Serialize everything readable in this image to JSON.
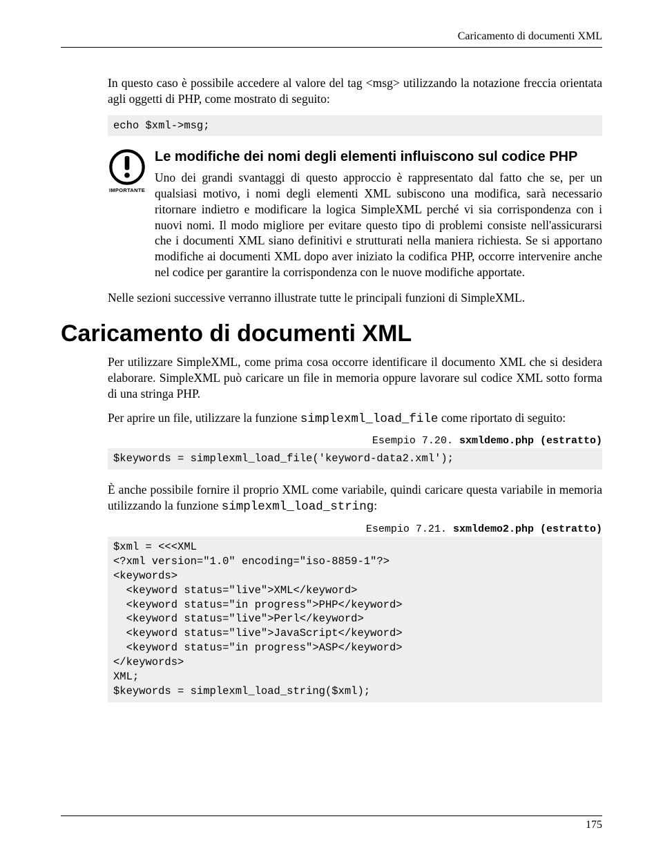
{
  "running_head": "Caricamento di documenti XML",
  "para1": "In questo caso è possibile accedere al valore del tag <msg> utilizzando la notazione freccia orientata agli oggetti di PHP, come mostrato di seguito:",
  "code1": "echo $xml->msg;",
  "callout": {
    "icon_label": "IMPORTANTE",
    "title": "Le modifiche dei nomi degli elementi influiscono sul codice PHP",
    "body": "Uno dei grandi svantaggi di questo approccio è rappresentato dal fatto che se, per un qualsiasi motivo, i nomi degli elementi XML subiscono una modifica, sarà necessario ritornare indietro e modificare la logica SimpleXML perché vi sia corrispondenza con i nuovi nomi. Il modo migliore per evitare questo tipo di problemi consiste nell'assicurarsi che i documenti XML siano definitivi e strutturati nella maniera richiesta. Se si apportano modifiche ai documenti XML dopo aver iniziato la codifica PHP, occorre intervenire anche nel codice per garantire la corrispondenza con le nuove modifiche apportate."
  },
  "para2": "Nelle sezioni successive verranno illustrate tutte le principali funzioni di SimpleXML.",
  "h1": "Caricamento di documenti XML",
  "para3": "Per utilizzare SimpleXML, come prima cosa occorre identificare il documento XML che si desidera elaborare. SimpleXML può caricare un file in memoria oppure lavorare sul codice XML sotto forma di una stringa PHP.",
  "para4_pre": "Per aprire un file, utilizzare la funzione ",
  "para4_code": "simplexml_load_file",
  "para4_post": " come riportato di seguito:",
  "ex1_label": "Esempio 7.20. ",
  "ex1_file": "sxmldemo.php (estratto)",
  "code2": "$keywords = simplexml_load_file('keyword-data2.xml');",
  "para5_pre": "È anche possibile fornire il proprio XML come variabile, quindi caricare questa variabile in memoria utilizzando la funzione ",
  "para5_code": "simplexml_load_string",
  "para5_post": ":",
  "ex2_label": "Esempio 7.21. ",
  "ex2_file": "sxmldemo2.php (estratto)",
  "code3": "$xml = <<<XML\n<?xml version=\"1.0\" encoding=\"iso-8859-1\"?>\n<keywords>\n  <keyword status=\"live\">XML</keyword>\n  <keyword status=\"in progress\">PHP</keyword>\n  <keyword status=\"live\">Perl</keyword>\n  <keyword status=\"live\">JavaScript</keyword>\n  <keyword status=\"in progress\">ASP</keyword>\n</keywords>\nXML;\n$keywords = simplexml_load_string($xml);",
  "page_number": "175"
}
